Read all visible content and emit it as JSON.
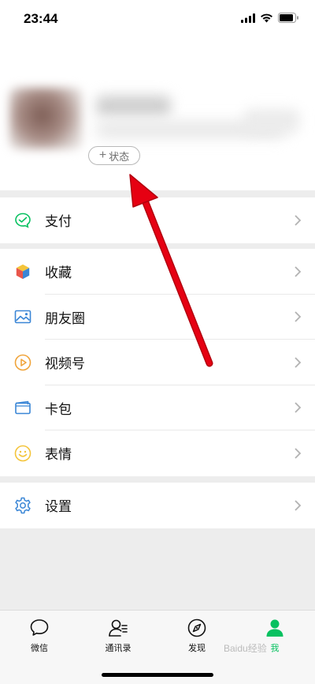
{
  "status_bar": {
    "time": "23:44",
    "icons": [
      "signal-icon",
      "wifi-icon",
      "battery-icon"
    ]
  },
  "profile": {
    "status_button": {
      "plus": "+",
      "label": "状态"
    }
  },
  "menu": {
    "pay": {
      "label": "支付",
      "icon": "pay-icon",
      "color": "#07c160"
    },
    "favorites": {
      "label": "收藏",
      "icon": "favorites-cube-icon"
    },
    "moments": {
      "label": "朋友圈",
      "icon": "moments-picture-icon",
      "color": "#3a86d6"
    },
    "channels": {
      "label": "视频号",
      "icon": "channels-play-icon",
      "color": "#f0a43a"
    },
    "cards": {
      "label": "卡包",
      "icon": "card-wallet-icon",
      "color": "#3a86d6"
    },
    "stickers": {
      "label": "表情",
      "icon": "sticker-smile-icon",
      "color": "#f4c43a"
    },
    "settings": {
      "label": "设置",
      "icon": "settings-gear-icon",
      "color": "#3a86d6"
    }
  },
  "tabbar": {
    "tabs": [
      {
        "label": "微信",
        "icon": "chat-bubble-icon"
      },
      {
        "label": "通讯录",
        "icon": "contacts-icon"
      },
      {
        "label": "发现",
        "icon": "discover-compass-icon"
      },
      {
        "label": "我",
        "icon": "me-person-icon",
        "active": true
      }
    ],
    "active_color": "#07c160"
  },
  "annotation": {
    "arrow_color": "#e60012"
  },
  "watermark": {
    "text": "Baidu经验"
  }
}
